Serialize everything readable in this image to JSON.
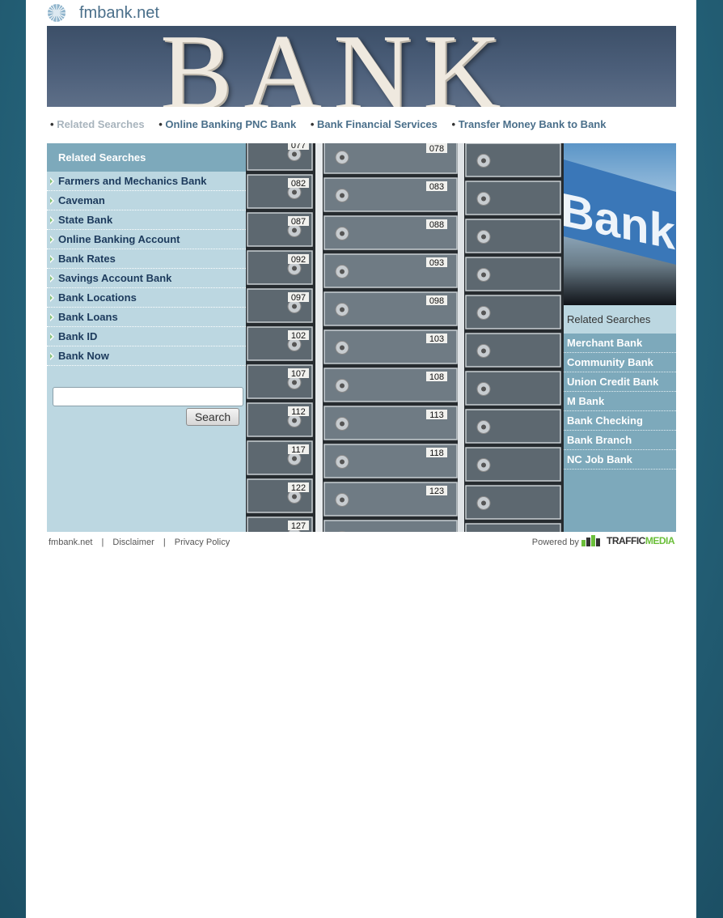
{
  "header": {
    "site_title": "fmbank.net",
    "banner_text": "BANK"
  },
  "topnav": {
    "items": [
      {
        "label": "Related Searches",
        "active": true
      },
      {
        "label": "Online Banking PNC Bank",
        "active": false
      },
      {
        "label": "Bank Financial Services",
        "active": false
      },
      {
        "label": "Transfer Money Bank to Bank",
        "active": false
      }
    ],
    "bullet": "•"
  },
  "left": {
    "heading": "Related Searches",
    "items": [
      "Farmers and Mechanics Bank",
      "Caveman",
      "State Bank",
      "Online Banking Account",
      "Bank Rates",
      "Savings Account Bank",
      "Bank Locations",
      "Bank Loans",
      "Bank ID",
      "Bank Now"
    ],
    "search_value": "",
    "search_button": "Search"
  },
  "hero": {
    "box_numbers": [
      [
        "077",
        "078",
        ""
      ],
      [
        "082",
        "083",
        ""
      ],
      [
        "087",
        "088",
        ""
      ],
      [
        "092",
        "093",
        ""
      ],
      [
        "097",
        "098",
        ""
      ],
      [
        "102",
        "103",
        ""
      ],
      [
        "107",
        "108",
        ""
      ],
      [
        "112",
        "113",
        ""
      ],
      [
        "117",
        "118",
        ""
      ],
      [
        "122",
        "123",
        ""
      ],
      [
        "127",
        "",
        ""
      ]
    ]
  },
  "right": {
    "image_text": "Bank",
    "heading": "Related Searches",
    "items": [
      "Merchant Bank",
      "Community Bank",
      "Union Credit Bank",
      "M Bank",
      "Bank Checking",
      "Bank Branch",
      "NC Job Bank"
    ]
  },
  "footer": {
    "site": "fmbank.net",
    "disclaimer": "Disclaimer",
    "privacy": "Privacy Policy",
    "separator": "|",
    "powered_by": "Powered by",
    "brand_part1": "TRAFFIC",
    "brand_part2": "MEDIA"
  },
  "colors": {
    "page_bg": "#2a6e86",
    "sidebar_light": "#bcd7e1",
    "sidebar_dark": "#7da9bb",
    "link": "#4a6f8a",
    "link_dark": "#1c3a5c"
  }
}
